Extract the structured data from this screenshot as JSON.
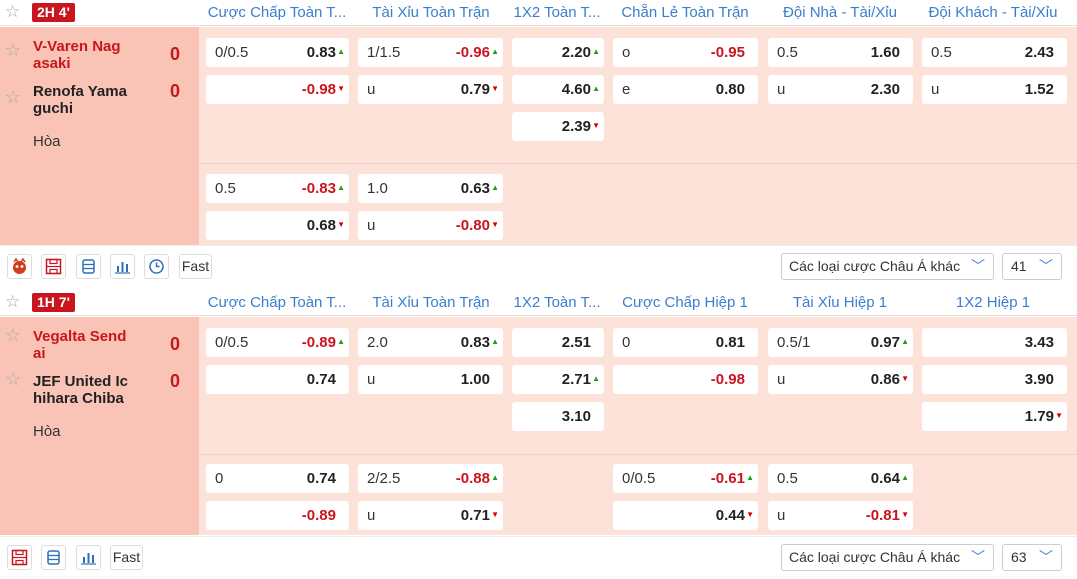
{
  "matches": [
    {
      "status": "2H  4'",
      "columns": [
        "Cược Chấp Toàn T...",
        "Tài Xỉu Toàn Trận",
        "1X2 Toàn T...",
        "Chẵn Lẻ Toàn Trận",
        "Đội Nhà - Tài/Xỉu",
        "Đội Khách - Tài/Xỉu"
      ],
      "home": {
        "name_line1": "V-Varen Nag",
        "name_line2": "asaki",
        "score": "0"
      },
      "away": {
        "name_line1": "Renofa Yama",
        "name_line2": "guchi",
        "score": "0"
      },
      "draw": "Hòa",
      "cells": [
        {
          "label": "0/0.5",
          "value": "0.83",
          "trend": "up"
        },
        {
          "label": "",
          "value": "-0.98",
          "trend": "down"
        },
        {
          "label": "1/1.5",
          "value": "-0.96",
          "trend": "up"
        },
        {
          "label": "u",
          "value": "0.79",
          "trend": "down"
        },
        {
          "label": "",
          "value": "2.20",
          "trend": "up"
        },
        {
          "label": "",
          "value": "4.60",
          "trend": "up"
        },
        {
          "label": "",
          "value": "2.39",
          "trend": "down"
        },
        {
          "label": "o",
          "value": "-0.95",
          "trend": ""
        },
        {
          "label": "e",
          "value": "0.80",
          "trend": ""
        },
        {
          "label": "0.5",
          "value": "1.60",
          "trend": ""
        },
        {
          "label": "u",
          "value": "2.30",
          "trend": ""
        },
        {
          "label": "0.5",
          "value": "2.43",
          "trend": ""
        },
        {
          "label": "u",
          "value": "1.52",
          "trend": ""
        },
        {
          "label": "0.5",
          "value": "-0.83",
          "trend": "up"
        },
        {
          "label": "",
          "value": "0.68",
          "trend": "down"
        },
        {
          "label": "1.0",
          "value": "0.63",
          "trend": "up"
        },
        {
          "label": "u",
          "value": "-0.80",
          "trend": "down"
        }
      ],
      "footer": {
        "fast": "Fast",
        "select": "Các loại cược Châu Á khác",
        "count": "41",
        "icons": [
          "mascot-icon",
          "field-icon",
          "list-icon",
          "bar-chart-icon",
          "history-icon"
        ]
      }
    },
    {
      "status": "1H  7'",
      "columns": [
        "Cược Chấp Toàn T...",
        "Tài Xỉu Toàn Trận",
        "1X2 Toàn T...",
        "Cược Chấp Hiệp 1",
        "Tài Xỉu Hiệp 1",
        "1X2 Hiệp 1"
      ],
      "home": {
        "name_line1": "Vegalta Send",
        "name_line2": "ai",
        "score": "0"
      },
      "away": {
        "name_line1": "JEF United Ic",
        "name_line2": "hihara Chiba",
        "score": "0"
      },
      "draw": "Hòa",
      "cells": [
        {
          "label": "0/0.5",
          "value": "-0.89",
          "trend": "up"
        },
        {
          "label": "",
          "value": "0.74",
          "trend": ""
        },
        {
          "label": "2.0",
          "value": "0.83",
          "trend": "up"
        },
        {
          "label": "u",
          "value": "1.00",
          "trend": ""
        },
        {
          "label": "",
          "value": "2.51",
          "trend": ""
        },
        {
          "label": "",
          "value": "2.71",
          "trend": "up"
        },
        {
          "label": "",
          "value": "3.10",
          "trend": ""
        },
        {
          "label": "0",
          "value": "0.81",
          "trend": ""
        },
        {
          "label": "",
          "value": "-0.98",
          "trend": ""
        },
        {
          "label": "0.5/1",
          "value": "0.97",
          "trend": "up"
        },
        {
          "label": "u",
          "value": "0.86",
          "trend": "down"
        },
        {
          "label": "",
          "value": "3.43",
          "trend": ""
        },
        {
          "label": "",
          "value": "3.90",
          "trend": ""
        },
        {
          "label": "",
          "value": "1.79",
          "trend": "down"
        },
        {
          "label": "0",
          "value": "0.74",
          "trend": ""
        },
        {
          "label": "",
          "value": "-0.89",
          "trend": ""
        },
        {
          "label": "2/2.5",
          "value": "-0.88",
          "trend": "up"
        },
        {
          "label": "u",
          "value": "0.71",
          "trend": "down"
        },
        {
          "label": "0/0.5",
          "value": "-0.61",
          "trend": "up"
        },
        {
          "label": "",
          "value": "0.44",
          "trend": "down"
        },
        {
          "label": "0.5",
          "value": "0.64",
          "trend": "up"
        },
        {
          "label": "u",
          "value": "-0.81",
          "trend": "down"
        }
      ],
      "footer": {
        "fast": "Fast",
        "select": "Các loại cược Châu Á khác",
        "count": "63",
        "icons": [
          "field-icon",
          "list-icon",
          "bar-chart-icon"
        ]
      }
    }
  ],
  "colors": {
    "accent": "#c9151e",
    "link": "#3a7fcf",
    "row_bg": "#fde2d9",
    "team_bg": "#f9c4b6",
    "up": "#1aa01a",
    "down": "#d40000"
  }
}
